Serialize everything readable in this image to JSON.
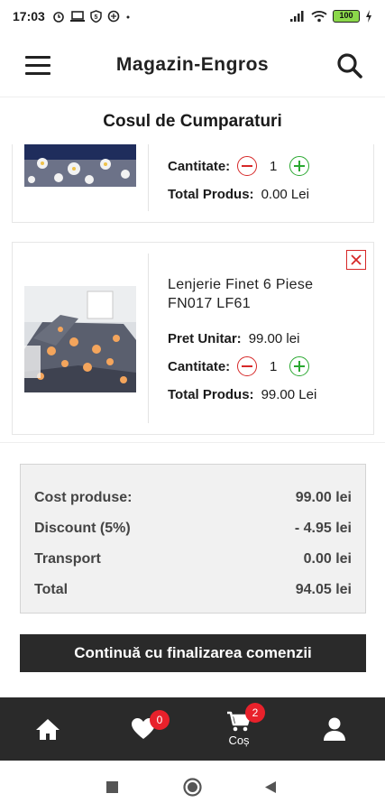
{
  "status_bar": {
    "time": "17:03",
    "battery": "100"
  },
  "header": {
    "title": "Magazin-Engros"
  },
  "page_title": "Cosul de Cumparaturi",
  "cart_items": [
    {
      "quantity_label": "Cantitate:",
      "quantity": "1",
      "total_label": "Total Produs:",
      "total": "0.00 Lei"
    },
    {
      "name": "Lenjerie Finet 6 Piese FN017 LF61",
      "unit_price_label": "Pret Unitar:",
      "unit_price": "99.00 lei",
      "quantity_label": "Cantitate:",
      "quantity": "1",
      "total_label": "Total Produs:",
      "total": "99.00 Lei"
    }
  ],
  "summary": {
    "rows": [
      {
        "label": "Cost produse:",
        "value": "99.00 lei"
      },
      {
        "label": "Discount (5%)",
        "value": "- 4.95 lei"
      },
      {
        "label": "Transport",
        "value": "0.00 lei"
      },
      {
        "label": "Total",
        "value": "94.05 lei"
      }
    ]
  },
  "checkout_button": "Continuă cu finalizarea comenzii",
  "bottom_nav": {
    "favorites_count": "0",
    "cart_count": "2",
    "cart_label": "Coș"
  },
  "colors": {
    "accent_dark": "#2a2a2a",
    "badge_red": "#e8212b",
    "minus_red": "#d62828",
    "plus_green": "#2aa830"
  }
}
